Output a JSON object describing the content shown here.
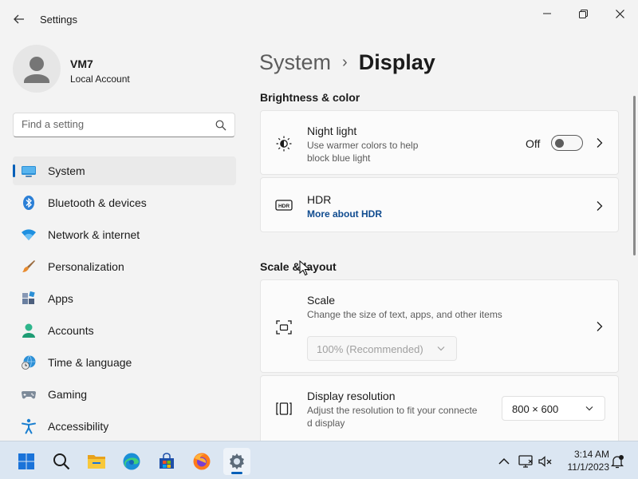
{
  "window": {
    "title": "Settings"
  },
  "profile": {
    "name": "VM7",
    "account_type": "Local Account"
  },
  "search": {
    "placeholder": "Find a setting",
    "value": ""
  },
  "sidebar": {
    "items": [
      {
        "label": "System",
        "icon": "system-icon",
        "active": true
      },
      {
        "label": "Bluetooth & devices",
        "icon": "bluetooth-icon"
      },
      {
        "label": "Network & internet",
        "icon": "wifi-icon"
      },
      {
        "label": "Personalization",
        "icon": "brush-icon"
      },
      {
        "label": "Apps",
        "icon": "apps-icon"
      },
      {
        "label": "Accounts",
        "icon": "person-icon"
      },
      {
        "label": "Time & language",
        "icon": "globe-clock-icon"
      },
      {
        "label": "Gaming",
        "icon": "gamepad-icon"
      },
      {
        "label": "Accessibility",
        "icon": "accessibility-icon"
      }
    ]
  },
  "breadcrumb": {
    "parent": "System",
    "separator": "›",
    "current": "Display"
  },
  "sections": {
    "brightness": "Brightness & color",
    "scale_layout": "Scale & layout"
  },
  "night_light": {
    "title": "Night light",
    "desc_line1": "Use warmer colors to help",
    "desc_line2": "block blue light",
    "state_label": "Off",
    "on": false
  },
  "hdr": {
    "title": "HDR",
    "link": "More about HDR"
  },
  "scale": {
    "title": "Scale",
    "desc": "Change the size of text, apps, and other items",
    "value": "100% (Recommended)",
    "enabled": false
  },
  "resolution": {
    "title": "Display resolution",
    "desc_line1": "Adjust the resolution to fit your connecte",
    "desc_line2": "d display",
    "value": "800 × 600"
  },
  "taskbar": {
    "apps": [
      "start-icon",
      "search-icon",
      "file-explorer-icon",
      "edge-icon",
      "store-icon",
      "firefox-icon",
      "settings-icon"
    ],
    "time": "3:14 AM",
    "date": "11/1/2023"
  },
  "colors": {
    "accent": "#005fb8",
    "background": "#f3f3f3",
    "card": "#fbfbfb",
    "taskbar": "#dbe6f2"
  }
}
